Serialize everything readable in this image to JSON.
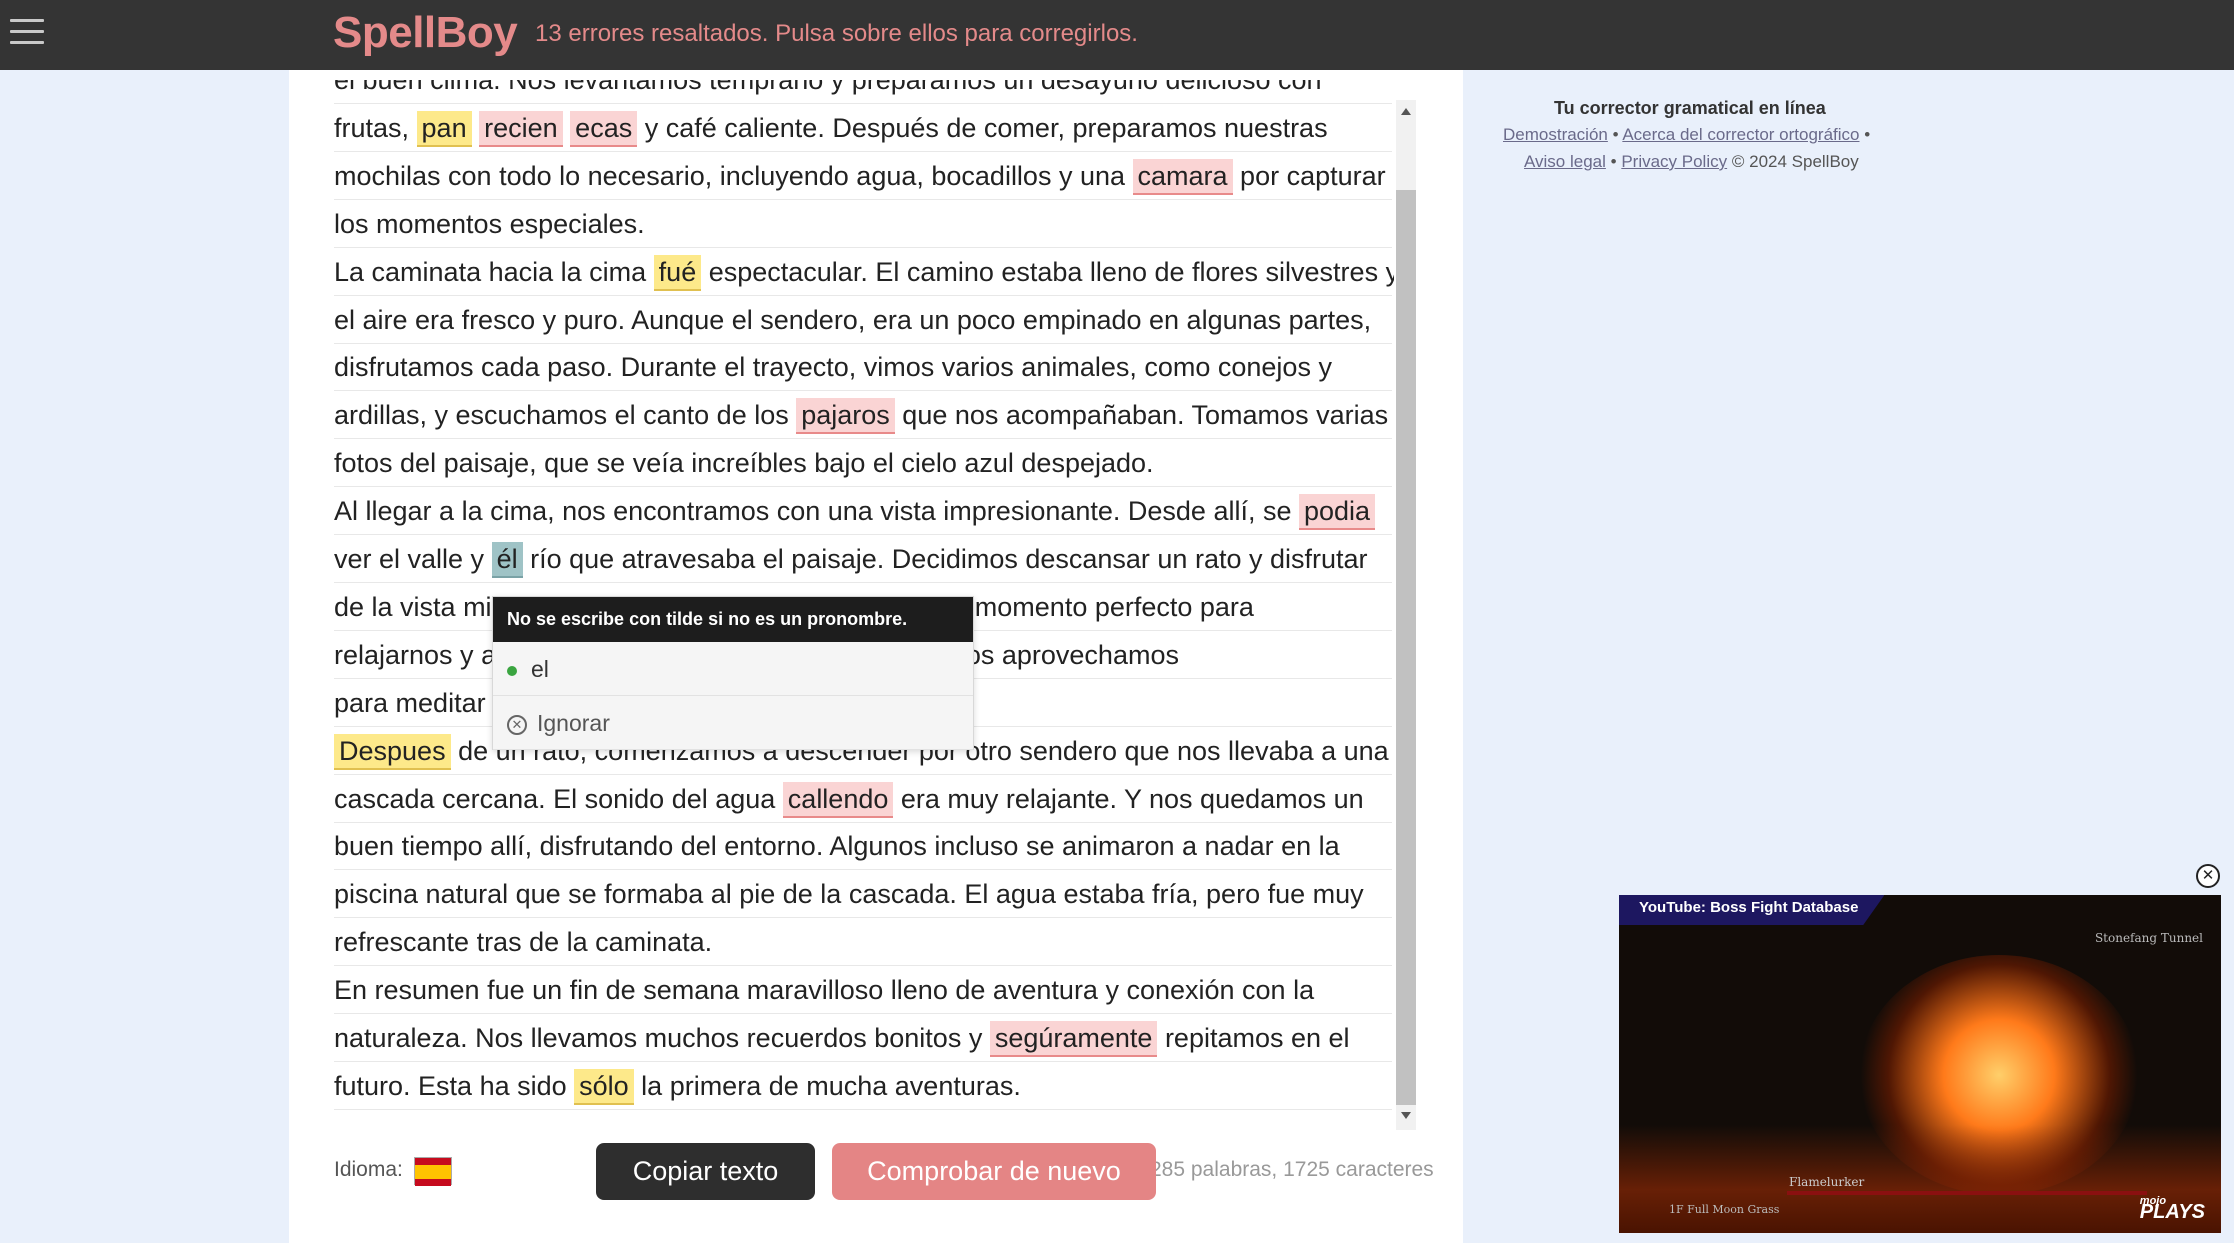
{
  "header": {
    "brand": "SpellBoy",
    "status": "13 errores resaltados. Pulsa sobre ellos para corregirlos."
  },
  "editor": {
    "lines": [
      [
        "el buen clima. Nos levantamos temprano y preparamos un desayuno delicioso con"
      ],
      [
        "frutas, ",
        {
          "t": "pan",
          "c": "yel"
        },
        " ",
        {
          "t": "recien",
          "c": "red"
        },
        " ",
        {
          "t": "ecas",
          "c": "red"
        },
        " y café caliente. Después de comer, preparamos nuestras"
      ],
      [
        "mochilas con todo lo necesario, incluyendo agua, bocadillos y una ",
        {
          "t": "camara",
          "c": "red"
        },
        " por capturar"
      ],
      [
        "los momentos especiales."
      ],
      [
        "La caminata hacia la cima ",
        {
          "t": "fué",
          "c": "yel"
        },
        " espectacular. El camino estaba lleno de flores silvestres y"
      ],
      [
        "el aire era fresco y puro. Aunque el sendero, era un poco empinado en algunas partes,"
      ],
      [
        "disfrutamos cada paso. Durante el trayecto, vimos varios animales, como conejos y"
      ],
      [
        "ardillas, y escuchamos el canto de los ",
        {
          "t": "pajaros",
          "c": "red"
        },
        " que nos acompañaban. Tomamos varias"
      ],
      [
        "fotos del paisaje, que se veía increíbles bajo el cielo azul despejado."
      ],
      [
        "Al llegar a la cima, nos encontramos con una vista impresionante. Desde allí, se ",
        {
          "t": "podia",
          "c": "red"
        }
      ],
      [
        "ver el valle y ",
        {
          "t": "él",
          "c": "sel"
        },
        " río que atravesaba el paisaje. Decidimos descansar un rato y disfrutar"
      ],
      [
        "de la vista mientras comíamos los bocadillos. Fue un momento perfecto para"
      ],
      [
        "relajarnos y admirar la naturaleza. Algunos de nosotros aprovechamos"
      ],
      [
        "para meditar"
      ],
      [
        {
          "t": "Despues",
          "c": "yel"
        },
        " de un rato, comenzamos a descender por otro sendero que nos llevaba a una"
      ],
      [
        "cascada cercana. El sonido del agua ",
        {
          "t": "callendo",
          "c": "red"
        },
        " era muy relajante. Y nos quedamos un"
      ],
      [
        "buen tiempo allí, disfrutando del entorno. Algunos incluso se animaron a nadar en la"
      ],
      [
        "piscina natural que se formaba al pie de la cascada. El agua estaba fría, pero fue muy"
      ],
      [
        "refrescante tras de la caminata."
      ],
      [
        "En resumen fue un fin de semana maravilloso lleno de aventura y conexión con la"
      ],
      [
        "naturaleza. Nos llevamos muchos recuerdos bonitos y ",
        {
          "t": "segúramente",
          "c": "red"
        },
        " repitamos en el"
      ],
      [
        "futuro. Esta ha sido ",
        {
          "t": "sólo",
          "c": "yel"
        },
        " la primera de mucha aventuras."
      ]
    ]
  },
  "popup": {
    "message": "No se escribe con tilde si no es un pronombre.",
    "suggestion": "el",
    "ignore_label": "Ignorar",
    "ignore_icon": "circle-x-icon"
  },
  "footer": {
    "language_label": "Idioma:",
    "flag_icon": "spain-flag-icon",
    "copy_button": "Copiar texto",
    "check_button": "Comprobar de nuevo",
    "counts": "285 palabras, 1725 caracteres"
  },
  "sidebar": {
    "title": "Tu corrector gramatical en línea",
    "link_demo": "Demostración",
    "link_about": "Acerca del corrector ortográfico",
    "link_legal": "Aviso legal",
    "link_privacy": "Privacy Policy",
    "copyright": "© 2024 SpellBoy"
  },
  "video": {
    "label": "YouTube: Boss Fight Database",
    "location": "Stonefang Tunnel",
    "boss": "Flamelurker",
    "sub": "1F Full Moon Grass",
    "brand_top": "mojo",
    "brand": "PLAYS",
    "close_icon": "close-circle-icon"
  },
  "colors": {
    "brand": "#e48a8a",
    "topbar": "#343434",
    "error_red": "#fad4d4",
    "warning_yellow": "#fde98a",
    "selected": "#9fc3c6"
  }
}
